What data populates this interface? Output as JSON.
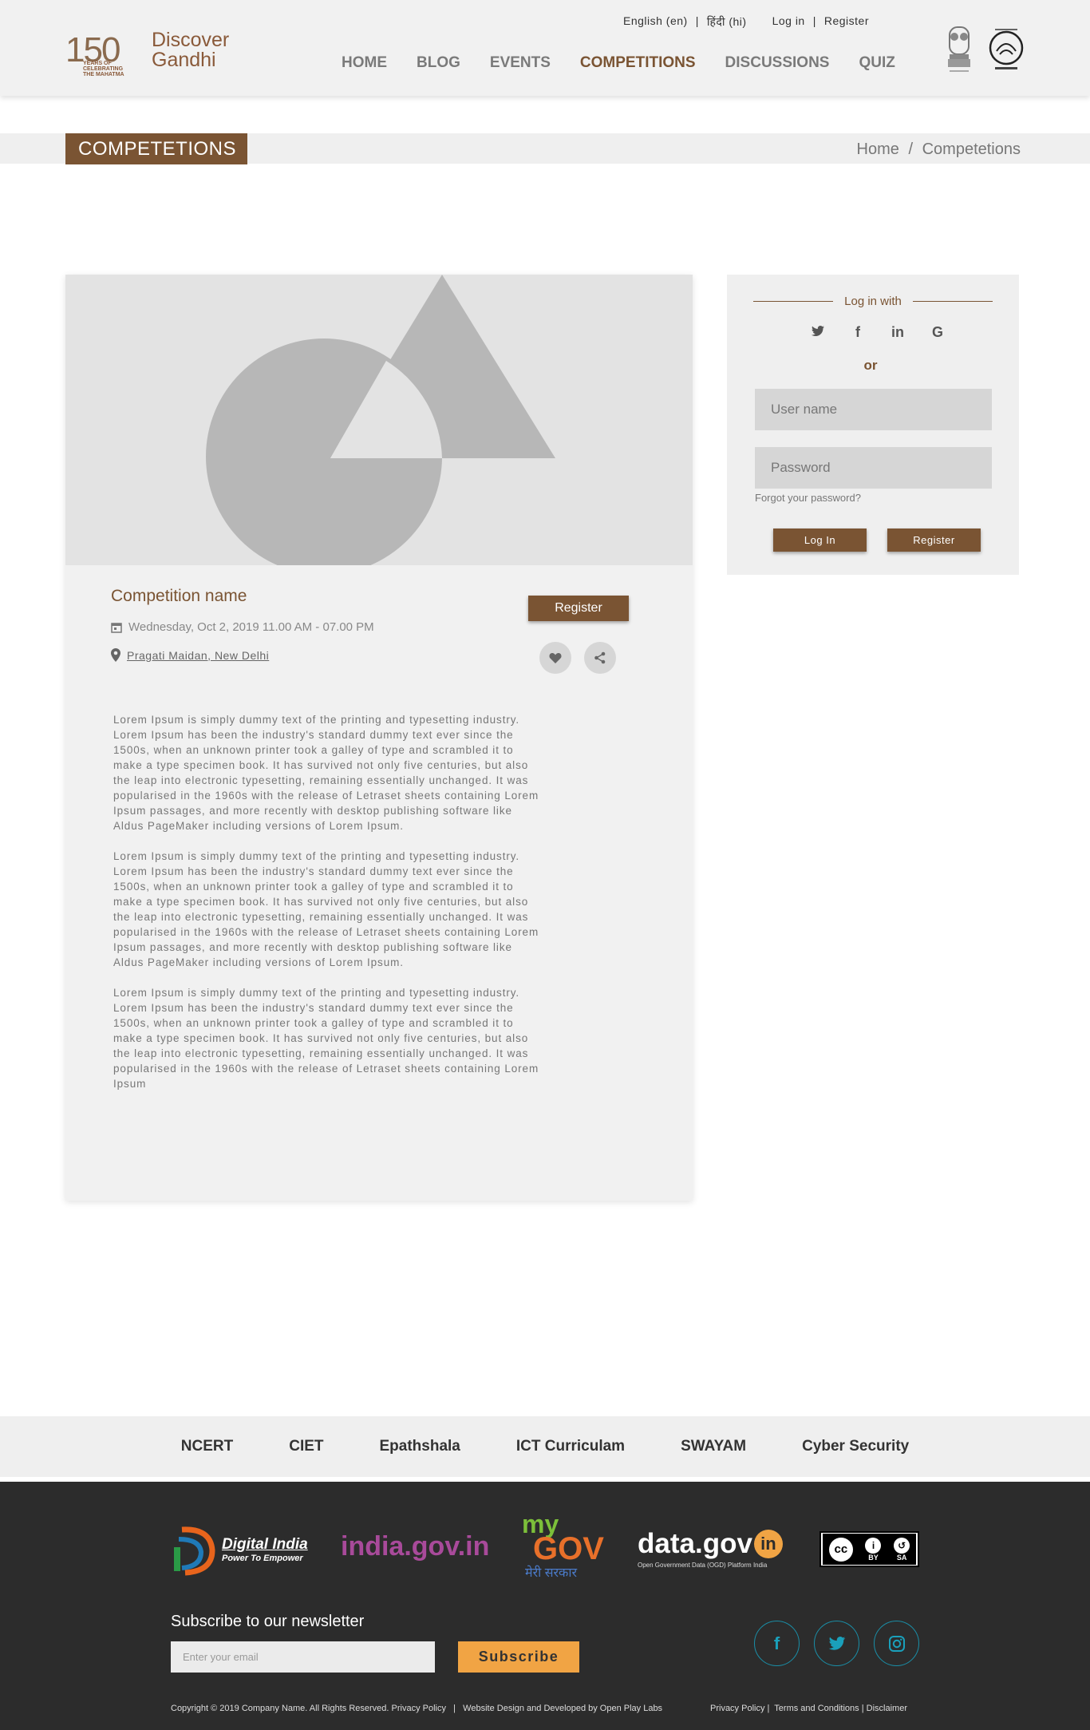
{
  "header": {
    "logo": {
      "number": "150",
      "subtitle_lines": [
        "YEARS OF",
        "CELEBRATING",
        "THE MAHATMA"
      ],
      "line1": "Discover",
      "line2": "Gandhi"
    },
    "topbar": {
      "lang_en": "English (en)",
      "lang_hi": "हिंदी (hi)",
      "login": "Log in",
      "register": "Register"
    },
    "nav": [
      {
        "label": "HOME",
        "active": false
      },
      {
        "label": "BLOG",
        "active": false
      },
      {
        "label": "EVENTS",
        "active": false
      },
      {
        "label": "COMPETITIONS",
        "active": true
      },
      {
        "label": "DISCUSSIONS",
        "active": false
      },
      {
        "label": "QUIZ",
        "active": false
      }
    ]
  },
  "page": {
    "title": "COMPETETIONS",
    "breadcrumb": {
      "home": "Home",
      "separator": "/",
      "current": "Competetions"
    }
  },
  "competition": {
    "name": "Competition name",
    "date": "Wednesday, Oct 2, 2019 11.00 AM - 07.00 PM",
    "location": "Pragati Maidan, New Delhi",
    "register_label": "Register",
    "paragraphs": [
      "Lorem Ipsum is simply dummy text of the printing and typesetting industry. Lorem Ipsum has been the industry's standard dummy text ever since the 1500s, when an unknown printer took a galley of type and scrambled it to make a type specimen book. It has survived not only five centuries, but also the leap into electronic typesetting, remaining essentially unchanged. It was popularised in the 1960s with the release of Letraset sheets containing Lorem Ipsum passages, and more recently with desktop publishing software like Aldus PageMaker including versions of Lorem Ipsum.",
      "Lorem Ipsum is simply dummy text of the printing and typesetting industry. Lorem Ipsum has been the industry's standard dummy text ever since the 1500s, when an unknown printer took a galley of type and scrambled it to make a type specimen book. It has survived not only five centuries, but also the leap into electronic typesetting, remaining essentially unchanged. It was popularised in the 1960s with the release of Letraset sheets containing Lorem Ipsum passages, and more recently with desktop publishing software like Aldus PageMaker including versions of Lorem Ipsum.",
      "Lorem Ipsum is simply dummy text of the printing and typesetting industry. Lorem Ipsum has been the industry's standard dummy text ever since the 1500s, when an unknown printer took a galley of type and scrambled it to make a type specimen book. It has survived not only five centuries, but also the leap into electronic typesetting, remaining essentially unchanged. It was popularised in the 1960s with the release of Letraset sheets containing Lorem Ipsum"
    ]
  },
  "login": {
    "heading": "Log in with",
    "or": "or",
    "username_placeholder": "User name",
    "password_placeholder": "Password",
    "forgot": "Forgot your password?",
    "login_button": "Log In",
    "register_button": "Register",
    "socials": [
      "twitter-icon",
      "facebook-icon",
      "linkedin-icon",
      "google-icon"
    ]
  },
  "footer_links": [
    "NCERT",
    "CIET",
    "Epathshala",
    "ICT Curriculam",
    "SWAYAM",
    "Cyber Security"
  ],
  "footer": {
    "partners": {
      "digital_india": {
        "title": "Digital India",
        "tagline": "Power To Empower"
      },
      "india_gov": "india.gov.in",
      "mygov": {
        "my": "my",
        "gov": "GOV",
        "hindi": "मेरी सरकार"
      },
      "datagov": {
        "text": "data.gov",
        "suffix": "in",
        "tagline": "Open Government Data (OGD) Platform India"
      },
      "cc": {
        "by": "BY",
        "sa": "SA"
      }
    },
    "newsletter_title": "Subscribe to our newsletter",
    "email_placeholder": "Enter your email",
    "subscribe": "Subscribe",
    "copyright": "Copyright © 2019 Company Name. All Rights Reserved. Privacy Policy   |   Website Design and Developed by Open Play Labs",
    "legal": "Privacy Policy |  Terms and Conditions | Disclaimer"
  },
  "colors": {
    "brand": "#7a5433",
    "accent": "#f1a444",
    "footer_bg": "#2c2c2c",
    "social": "#1aa0bb"
  }
}
